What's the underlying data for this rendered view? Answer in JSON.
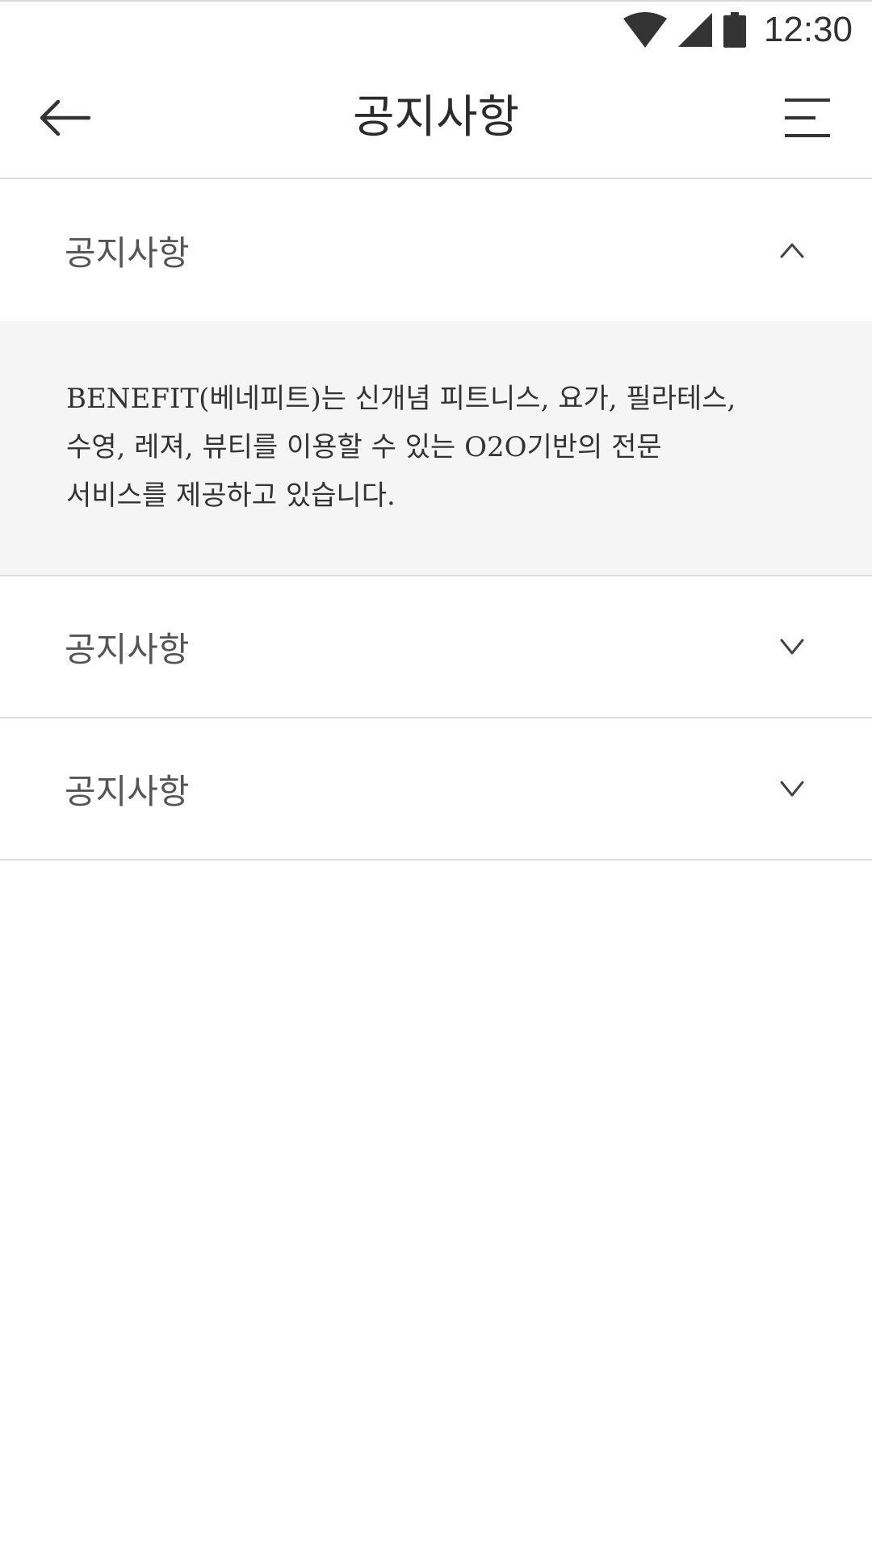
{
  "status_bar": {
    "time": "12:30",
    "icons": [
      "wifi-icon",
      "cellular-signal-icon",
      "battery-icon"
    ]
  },
  "header": {
    "title": "공지사항",
    "back_icon": "arrow-left-icon",
    "menu_icon": "menu-icon"
  },
  "notices": [
    {
      "title": "공지사항",
      "expanded": true,
      "chevron": "chevron-up-icon",
      "content": "BENEFIT(베네피트)는 신개념 피트니스, 요가, 필라테스,\n수영, 레져, 뷰티를 이용할 수 있는 O2O기반의 전문\n서비스를 제공하고 있습니다."
    },
    {
      "title": "공지사항",
      "expanded": false,
      "chevron": "chevron-down-icon"
    },
    {
      "title": "공지사항",
      "expanded": false,
      "chevron": "chevron-down-icon"
    }
  ],
  "colors": {
    "background": "#ffffff",
    "text": "#333333",
    "divider": "#dedede",
    "expanded_panel": "#f5f5f5"
  }
}
